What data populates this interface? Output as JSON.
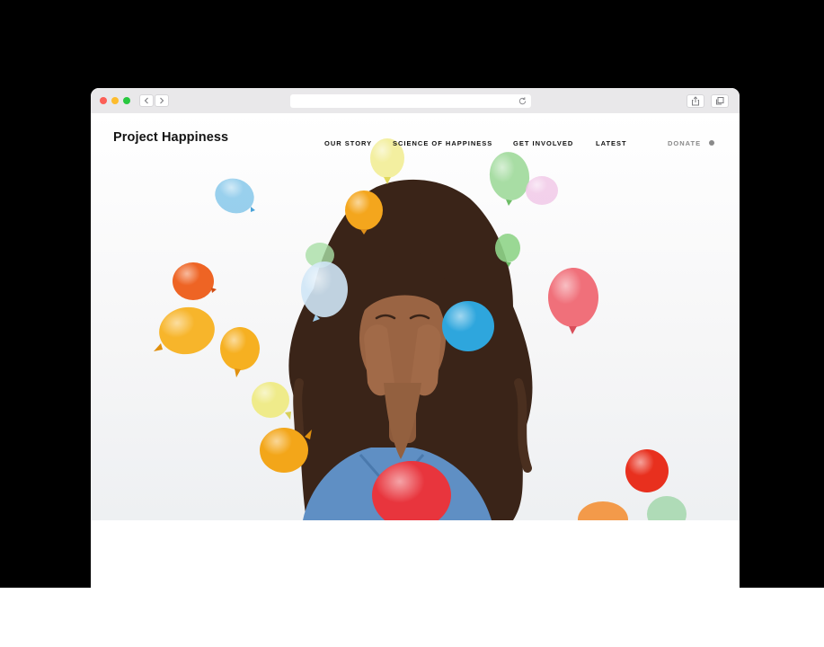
{
  "site": {
    "brand": "Project Happiness",
    "nav": [
      {
        "label": "OUR STORY"
      },
      {
        "label": "SCIENCE OF HAPPINESS"
      },
      {
        "label": "GET INVOLVED"
      },
      {
        "label": "LATEST"
      }
    ],
    "donate_label": "DONATE"
  },
  "colors": {
    "traffic_red": "#fc5f57",
    "traffic_yellow": "#fdbc2e",
    "traffic_green": "#29c840",
    "browser_chrome": "#e9e8ea",
    "page_background": "#ffffff",
    "nav_text": "#111111",
    "donate_text": "#8a8a8a"
  },
  "icons": {
    "back": "chevron-left-icon",
    "forward": "chevron-right-icon",
    "reload": "reload-icon",
    "share": "share-icon",
    "tabs": "tabs-icon"
  }
}
